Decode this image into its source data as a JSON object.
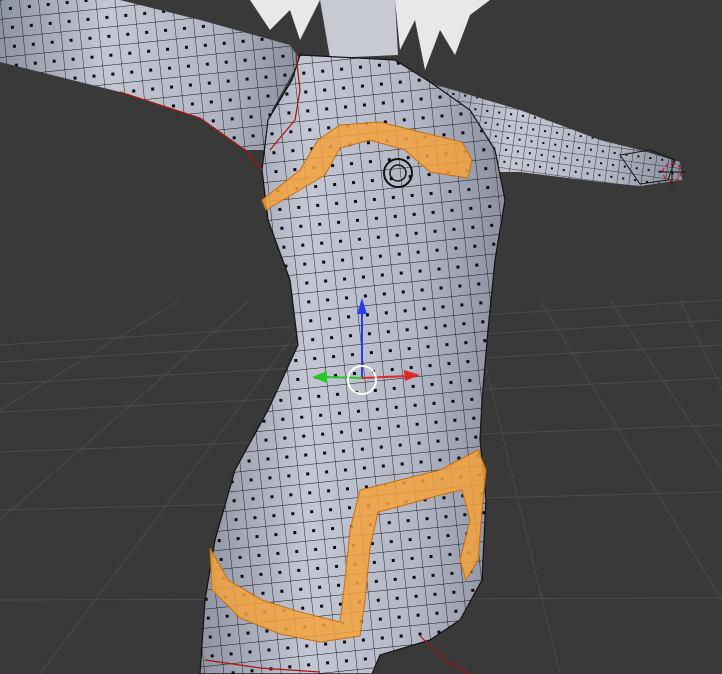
{
  "viewport": {
    "mode": "edit-mode-face-select",
    "background_color": "#393939",
    "grid_color": "#4a4a4a",
    "mesh_fill_color": "#b9bdcb",
    "wire_color": "#141414",
    "selection_color": "#f4a23d",
    "seam_color": "#b01010"
  },
  "manipulator": {
    "axes": [
      {
        "name": "x-axis",
        "color": "#e02828"
      },
      {
        "name": "y-axis",
        "color": "#28c828"
      },
      {
        "name": "z-axis",
        "color": "#2a3cf0"
      }
    ]
  },
  "cursor_3d": {
    "icon": "3d-cursor-icon",
    "color": "#d42020"
  }
}
